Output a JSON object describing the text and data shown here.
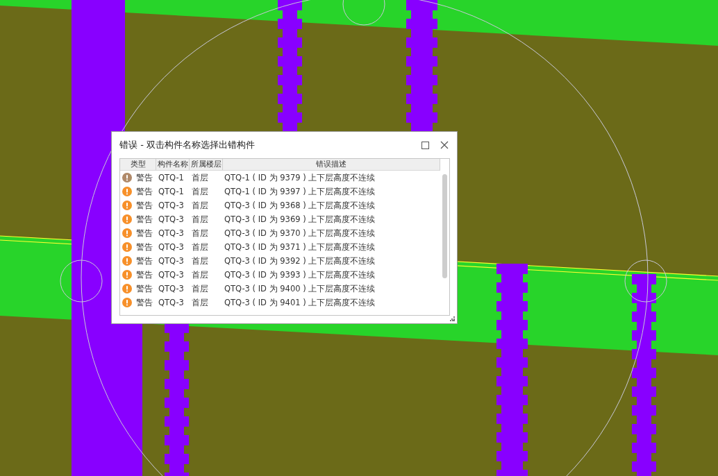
{
  "dialog": {
    "title": "错误 - 双击构件名称选择出错构件",
    "columns": [
      "类型",
      "构件名称",
      "所属楼层",
      "错误描述"
    ],
    "rows": [
      {
        "type": "警告",
        "name": "QTQ-1",
        "floor": "首层",
        "description": "QTQ-1 ( ID 为 9379 ) 上下层高度不连续",
        "color": "#b08a6a"
      },
      {
        "type": "警告",
        "name": "QTQ-1",
        "floor": "首层",
        "description": "QTQ-1 ( ID 为 9397 ) 上下层高度不连续",
        "color": "#f7902a"
      },
      {
        "type": "警告",
        "name": "QTQ-3",
        "floor": "首层",
        "description": "QTQ-3 ( ID 为 9368 ) 上下层高度不连续",
        "color": "#f7902a"
      },
      {
        "type": "警告",
        "name": "QTQ-3",
        "floor": "首层",
        "description": "QTQ-3 ( ID 为 9369 ) 上下层高度不连续",
        "color": "#f7902a"
      },
      {
        "type": "警告",
        "name": "QTQ-3",
        "floor": "首层",
        "description": "QTQ-3 ( ID 为 9370 ) 上下层高度不连续",
        "color": "#f7902a"
      },
      {
        "type": "警告",
        "name": "QTQ-3",
        "floor": "首层",
        "description": "QTQ-3 ( ID 为 9371 ) 上下层高度不连续",
        "color": "#f7902a"
      },
      {
        "type": "警告",
        "name": "QTQ-3",
        "floor": "首层",
        "description": "QTQ-3 ( ID 为 9392 ) 上下层高度不连续",
        "color": "#f7902a"
      },
      {
        "type": "警告",
        "name": "QTQ-3",
        "floor": "首层",
        "description": "QTQ-3 ( ID 为 9393 ) 上下层高度不连续",
        "color": "#f7902a"
      },
      {
        "type": "警告",
        "name": "QTQ-3",
        "floor": "首层",
        "description": "QTQ-3 ( ID 为 9400 ) 上下层高度不连续",
        "color": "#f7902a"
      },
      {
        "type": "警告",
        "name": "QTQ-3",
        "floor": "首层",
        "description": "QTQ-3 ( ID 为 9401 ) 上下层高度不连续",
        "color": "#f7902a"
      }
    ]
  }
}
